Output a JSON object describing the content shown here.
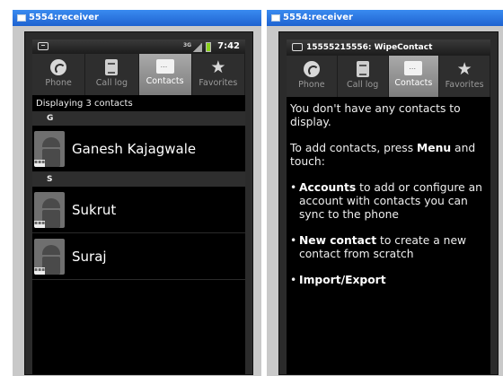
{
  "left_window": {
    "title": "5554:receiver",
    "statusbar": {
      "time": "7:42",
      "net_label": "3G"
    },
    "tabs": [
      {
        "label": "Phone",
        "icon": "phone-icon"
      },
      {
        "label": "Call log",
        "icon": "call-log-icon"
      },
      {
        "label": "Contacts",
        "icon": "contacts-icon",
        "active": true
      },
      {
        "label": "Favorites",
        "icon": "star-icon"
      }
    ],
    "info": "Displaying 3 contacts",
    "sections": [
      {
        "letter": "G",
        "contacts": [
          "Ganesh Kajagwale"
        ]
      },
      {
        "letter": "S",
        "contacts": [
          "Sukrut",
          "Suraj"
        ]
      }
    ]
  },
  "right_window": {
    "title": "5554:receiver",
    "notification_title": "15555215556: WipeContact",
    "tabs": [
      {
        "label": "Phone",
        "icon": "phone-icon"
      },
      {
        "label": "Call log",
        "icon": "call-log-icon"
      },
      {
        "label": "Contacts",
        "icon": "contacts-icon",
        "active": true
      },
      {
        "label": "Favorites",
        "icon": "star-icon"
      }
    ],
    "empty": {
      "line1": "You don't have any contacts to display.",
      "line2_prefix": "To add contacts, press ",
      "line2_bold": "Menu",
      "line2_suffix": " and touch:",
      "bullets": [
        {
          "bold": "Accounts",
          "text": " to add or configure an account with contacts you can sync to the phone"
        },
        {
          "bold": "New contact",
          "text": " to create a new contact from scratch"
        },
        {
          "bold": "Import/Export",
          "text": ""
        }
      ]
    }
  },
  "colors": {
    "titlebar": "#1e62d0",
    "active_tab": "#9a9a9a",
    "battery": "#8ad21c"
  }
}
